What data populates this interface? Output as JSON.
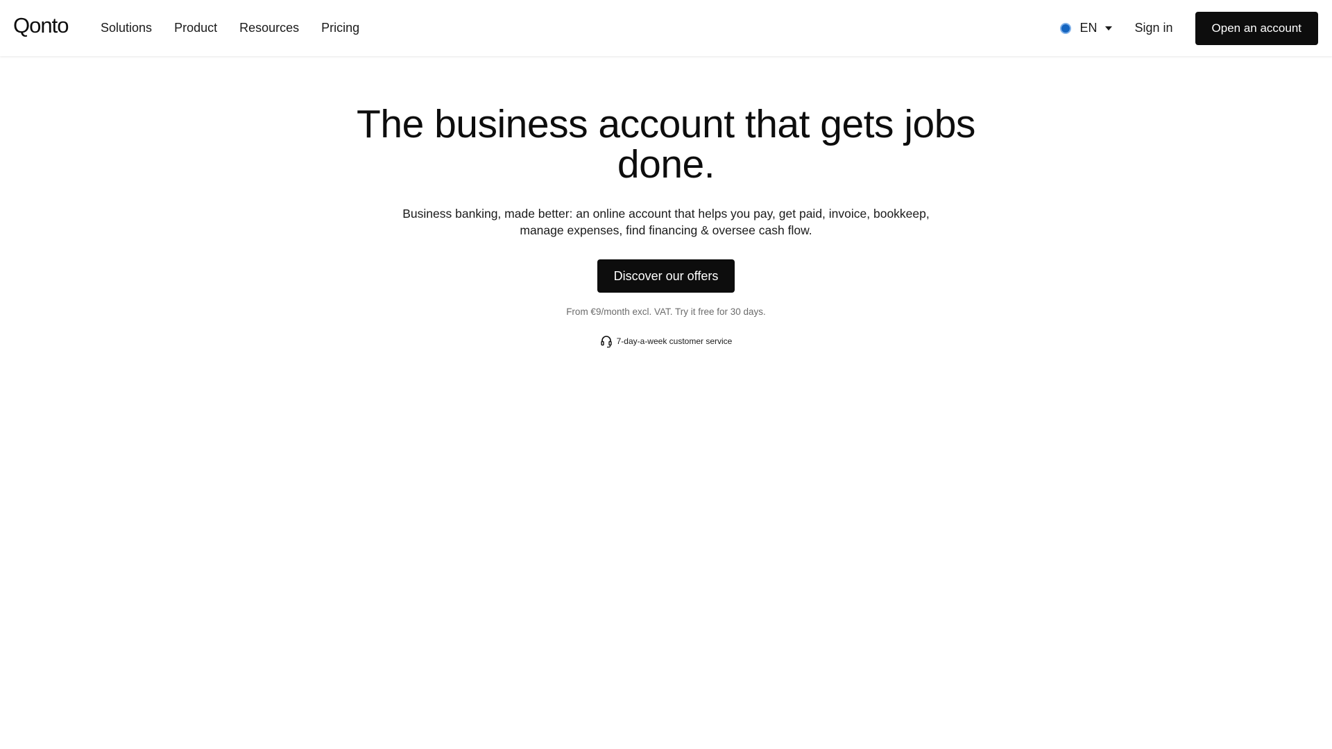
{
  "header": {
    "logo": "Qonto",
    "nav": [
      {
        "label": "Solutions"
      },
      {
        "label": "Product"
      },
      {
        "label": "Resources"
      },
      {
        "label": "Pricing"
      }
    ],
    "language": "EN",
    "sign_in": "Sign in",
    "open_account": "Open an account"
  },
  "hero": {
    "title": "The business account that gets jobs done.",
    "subtitle": "Business banking, made better: an online account that helps you pay, get paid, invoice, bookkeep, manage expenses, find financing & oversee cash flow.",
    "cta": "Discover our offers",
    "price_note": "From €9/month excl. VAT. Try it free for 30 days.",
    "support": "7-day-a-week customer service"
  },
  "icons": {
    "language": "globe-icon",
    "language_caret": "caret-down-icon",
    "support": "headset-icon"
  },
  "colors": {
    "primary_button": "#0d0d0d",
    "globe": "#1565c0"
  }
}
